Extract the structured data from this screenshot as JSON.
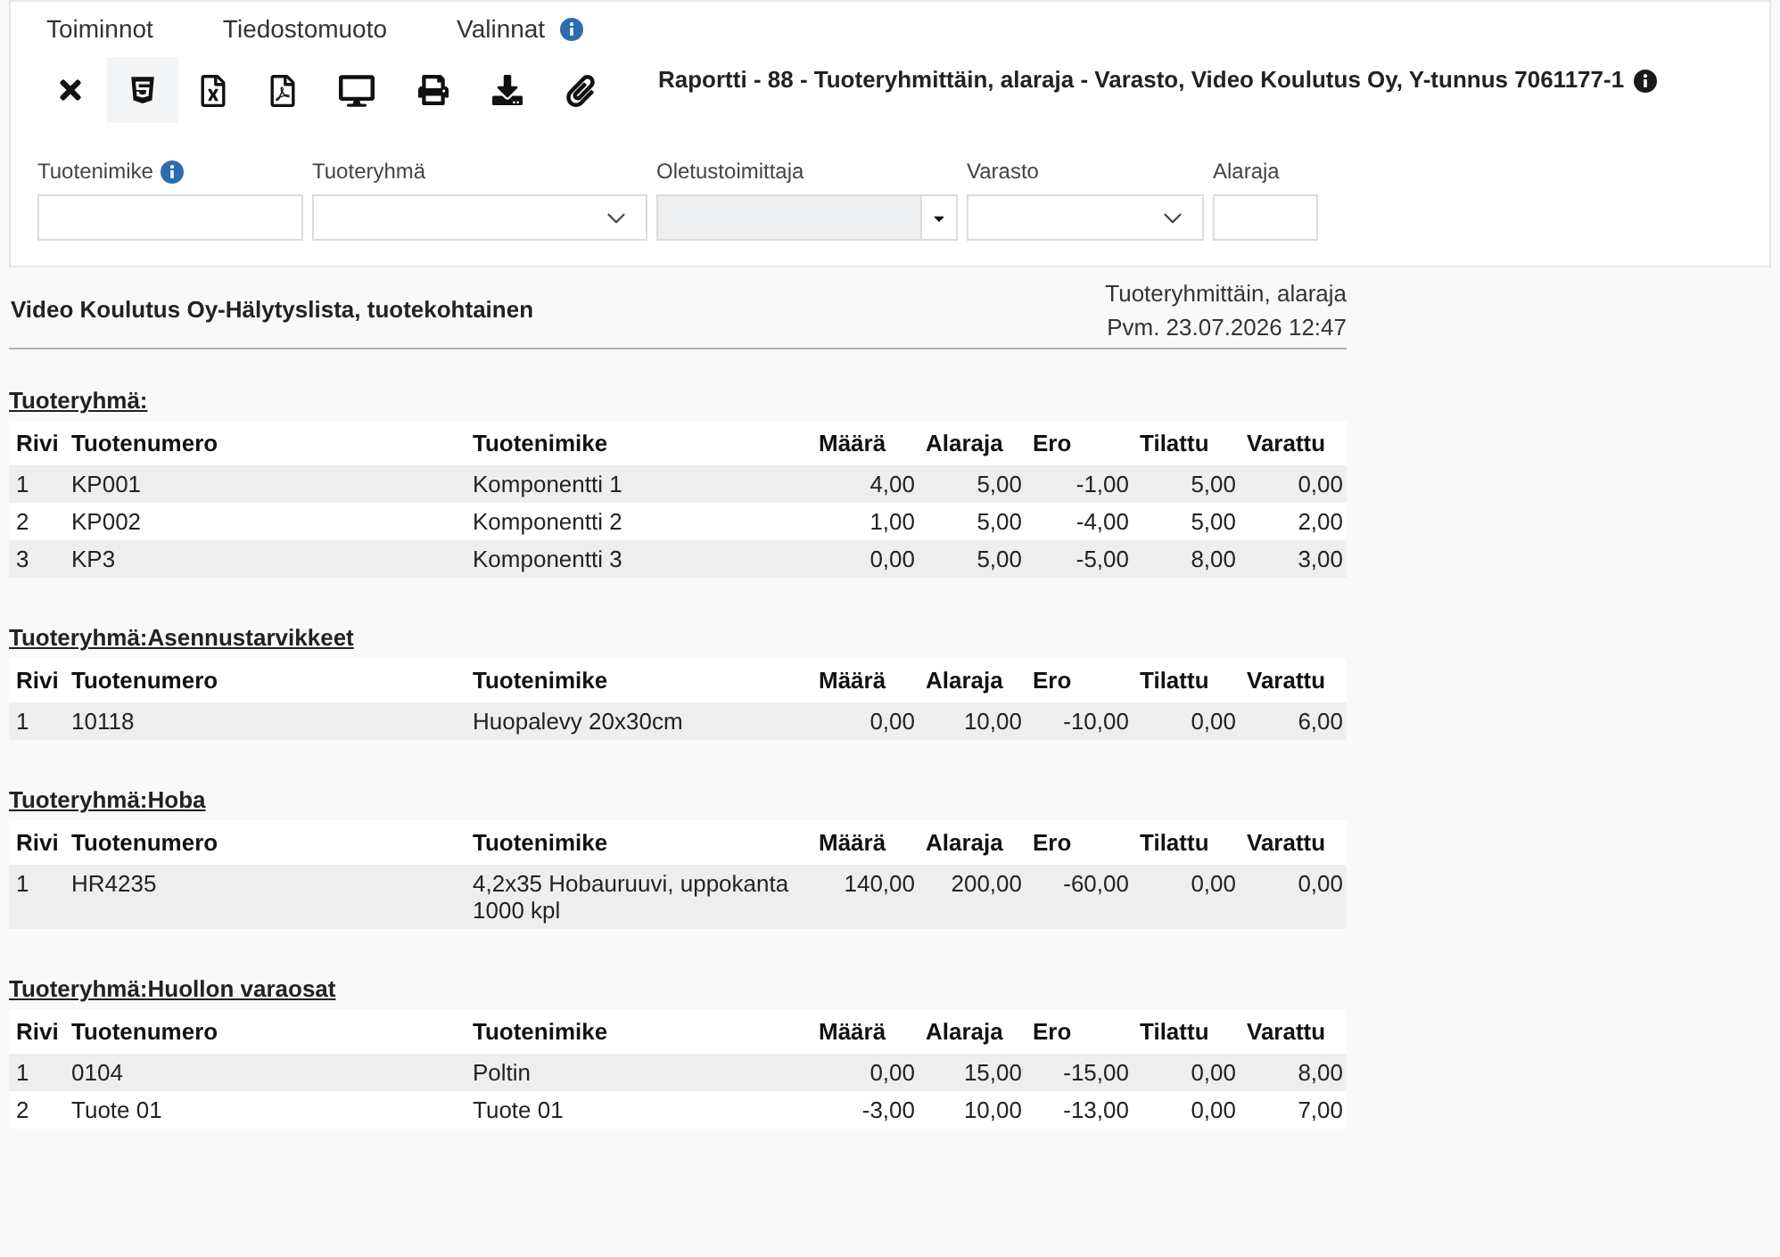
{
  "menu": [
    {
      "label": "Toiminnot",
      "info": false
    },
    {
      "label": "Tiedostomuoto",
      "info": false
    },
    {
      "label": "Valinnat",
      "info": true
    }
  ],
  "toolbar": [
    {
      "kind": "close",
      "selected": false
    },
    {
      "kind": "html",
      "selected": true
    },
    {
      "kind": "excel",
      "selected": false
    },
    {
      "kind": "pdf",
      "selected": false
    },
    {
      "kind": "screen",
      "selected": false
    },
    {
      "kind": "print",
      "selected": false
    },
    {
      "kind": "download",
      "selected": false
    },
    {
      "kind": "attach",
      "selected": false
    }
  ],
  "report_title": {
    "text": "Raportti - 88 - Tuoteryhmittäin, alaraja - Varasto, Video Koulutus Oy, Y-tunnus 7061177-1",
    "info": true
  },
  "filters": [
    {
      "label": "Tuotenimike",
      "kind": "text",
      "info": true,
      "disabled": false
    },
    {
      "label": "Tuoteryhmä",
      "kind": "select",
      "info": false,
      "disabled": false
    },
    {
      "label": "Oletustoimittaja",
      "kind": "combo",
      "info": false,
      "disabled": true
    },
    {
      "label": "Varasto",
      "kind": "select",
      "info": false,
      "disabled": false
    },
    {
      "label": "Alaraja",
      "kind": "text",
      "info": false,
      "disabled": false
    }
  ],
  "report": {
    "title": "Video Koulutus Oy-Hälytyslista, tuotekohtainen",
    "subtitle": "Tuoteryhmittäin, alaraja",
    "date": "Pvm. 23.07.2026 12:47",
    "groups": [
      {
        "title": "Tuoteryhmä:",
        "columns": [
          "Rivi",
          "Tuotenumero",
          "Tuotenimike",
          "Määrä",
          "Alaraja",
          "Ero",
          "Tilattu",
          "Varattu"
        ],
        "rows": [
          [
            "1",
            "KP001",
            "Komponentti 1",
            "4,00",
            "5,00",
            "-1,00",
            "5,00",
            "0,00"
          ],
          [
            "2",
            "KP002",
            "Komponentti 2",
            "1,00",
            "5,00",
            "-4,00",
            "5,00",
            "2,00"
          ],
          [
            "3",
            "KP3",
            "Komponentti 3",
            "0,00",
            "5,00",
            "-5,00",
            "8,00",
            "3,00"
          ]
        ]
      },
      {
        "title": "Tuoteryhmä:Asennustarvikkeet",
        "columns": [
          "Rivi",
          "Tuotenumero",
          "Tuotenimike",
          "Määrä",
          "Alaraja",
          "Ero",
          "Tilattu",
          "Varattu"
        ],
        "rows": [
          [
            "1",
            "10118",
            "Huopalevy 20x30cm",
            "0,00",
            "10,00",
            "-10,00",
            "0,00",
            "6,00"
          ]
        ]
      },
      {
        "title": "Tuoteryhmä:Hoba",
        "columns": [
          "Rivi",
          "Tuotenumero",
          "Tuotenimike",
          "Määrä",
          "Alaraja",
          "Ero",
          "Tilattu",
          "Varattu"
        ],
        "rows": [
          [
            "1",
            "HR4235",
            "4,2x35 Hobauruuvi, uppokanta 1000 kpl",
            "140,00",
            "200,00",
            "-60,00",
            "0,00",
            "0,00"
          ]
        ]
      },
      {
        "title": "Tuoteryhmä:Huollon varaosat",
        "columns": [
          "Rivi",
          "Tuotenumero",
          "Tuotenimike",
          "Määrä",
          "Alaraja",
          "Ero",
          "Tilattu",
          "Varattu"
        ],
        "rows": [
          [
            "1",
            "0104",
            "Poltin",
            "0,00",
            "15,00",
            "-15,00",
            "0,00",
            "8,00"
          ],
          [
            "2",
            "Tuote 01",
            "Tuote 01",
            "-3,00",
            "10,00",
            "-13,00",
            "0,00",
            "7,00"
          ]
        ]
      }
    ]
  }
}
